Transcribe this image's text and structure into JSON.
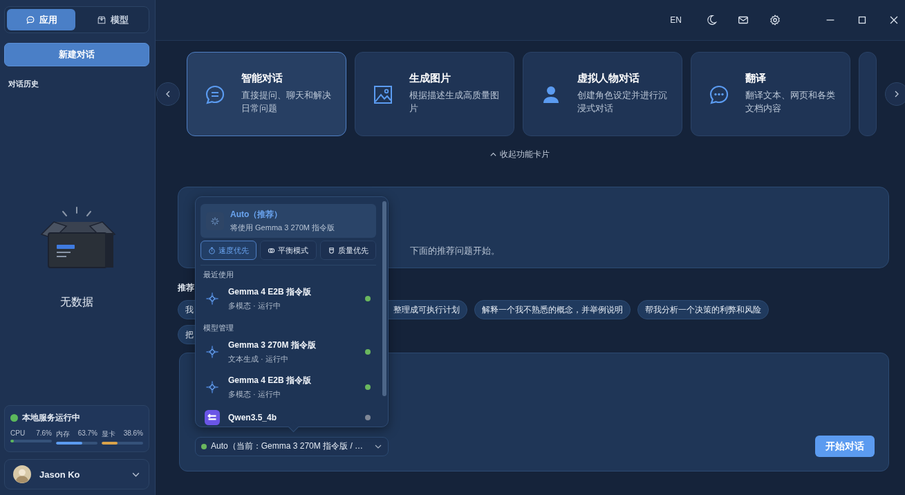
{
  "sidebar": {
    "tabs": [
      {
        "label": "应用",
        "selected": true
      },
      {
        "label": "模型",
        "selected": false
      }
    ],
    "new_chat": "新建对话",
    "history_title": "对话历史",
    "empty_text": "无数据",
    "service": {
      "status": "本地服务运行中",
      "color": "#5cb85c",
      "metrics": [
        {
          "label": "CPU",
          "value": "7.6%",
          "level": 0.076,
          "color": "#5cb85c"
        },
        {
          "label": "内存",
          "value": "63.7%",
          "level": 0.637,
          "color": "#5b9bf0"
        },
        {
          "label": "显卡",
          "value": "38.6%",
          "level": 0.386,
          "color": "#d9a24a"
        }
      ]
    },
    "user": {
      "name": "Jason Ko"
    }
  },
  "topbar": {
    "language": "EN"
  },
  "feature_cards": [
    {
      "title": "智能对话",
      "desc": "直接提问、聊天和解决日常问题",
      "selected": true
    },
    {
      "title": "生成图片",
      "desc": "根据描述生成高质量图片",
      "selected": false
    },
    {
      "title": "虚拟人物对话",
      "desc": "创建角色设定并进行沉浸式对话",
      "selected": false
    },
    {
      "title": "翻译",
      "desc": "翻译文本、网页和各类文档内容",
      "selected": false
    }
  ],
  "collapse_label": "收起功能卡片",
  "welcome": {
    "desc_tail": "下面的推荐问题开始。"
  },
  "recommend_label": "推荐",
  "chips": [
    {
      "text": "我",
      "kind": "cut_right"
    },
    {
      "text": "整理成可执行计划",
      "kind": "cut_left"
    },
    {
      "text": "解释一个我不熟悉的概念，并举例说明",
      "kind": "full"
    },
    {
      "text": "帮我分析一个决策的利弊和风险",
      "kind": "full"
    },
    {
      "text": "把",
      "kind": "cut_right"
    }
  ],
  "model_menu": {
    "auto": {
      "title": "Auto（推荐）",
      "subtitle": "将使用 Gemma 3 270M 指令版"
    },
    "modes": [
      {
        "label": "速度优先",
        "selected": true
      },
      {
        "label": "平衡模式",
        "selected": false
      },
      {
        "label": "质量优先",
        "selected": false
      }
    ],
    "sections": [
      {
        "title": "最近使用",
        "models": [
          {
            "name": "Gemma 4 E2B 指令版",
            "desc": "多模态 · 运行中",
            "kind": "gemma",
            "color": "#6ab75e"
          }
        ]
      },
      {
        "title": "模型管理",
        "models": [
          {
            "name": "Gemma 3 270M 指令版",
            "desc": "文本生成 · 运行中",
            "kind": "gemma",
            "color": "#6ab75e"
          },
          {
            "name": "Gemma 4 E2B 指令版",
            "desc": "多模态 · 运行中",
            "kind": "gemma",
            "color": "#6ab75e"
          },
          {
            "name": "Qwen3.5_4b",
            "kind": "qwen",
            "color": "#7f8796"
          }
        ]
      }
    ]
  },
  "model_select": {
    "label": "Auto（当前：Gemma 3 270M 指令版 / …",
    "color": "#6ab75e"
  },
  "start_button": "开始对话"
}
